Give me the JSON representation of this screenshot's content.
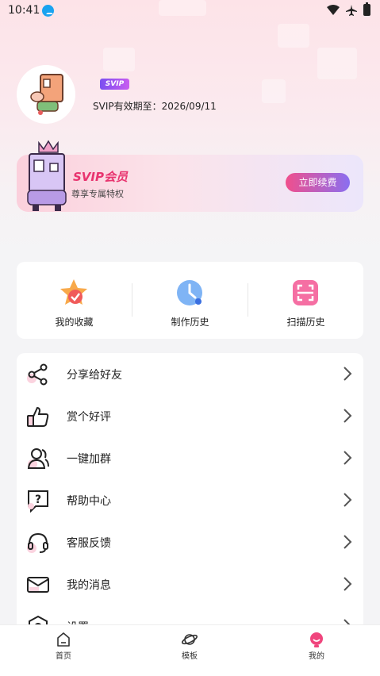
{
  "status_bar": {
    "time": "10:41"
  },
  "profile": {
    "badge": "SVIP",
    "expire_text": "SVIP有效期至：2026/09/11"
  },
  "vip_banner": {
    "title": "SVIP会员",
    "subtitle": "尊享专属特权",
    "button": "立即续费"
  },
  "quick_actions": [
    {
      "label": "我的收藏",
      "icon": "star-icon"
    },
    {
      "label": "制作历史",
      "icon": "clock-icon"
    },
    {
      "label": "扫描历史",
      "icon": "scan-icon"
    }
  ],
  "menu": [
    {
      "label": "分享给好友",
      "icon": "share-icon"
    },
    {
      "label": "赏个好评",
      "icon": "thumbs-up-icon"
    },
    {
      "label": "一键加群",
      "icon": "group-icon"
    },
    {
      "label": "帮助中心",
      "icon": "help-icon"
    },
    {
      "label": "客服反馈",
      "icon": "headset-icon"
    },
    {
      "label": "我的消息",
      "icon": "mail-icon"
    },
    {
      "label": "设置",
      "icon": "settings-icon"
    }
  ],
  "bottom_nav": [
    {
      "label": "首页",
      "icon": "home-icon"
    },
    {
      "label": "模板",
      "icon": "planet-icon"
    },
    {
      "label": "我的",
      "icon": "profile-icon"
    }
  ],
  "colors": {
    "accent_pink": "#e8346f",
    "button_gradient_start": "#f04f8c",
    "button_gradient_end": "#8a6ff0"
  }
}
